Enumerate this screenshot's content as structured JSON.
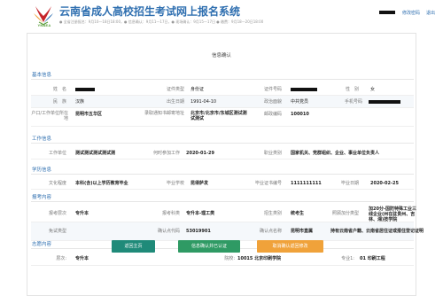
{
  "header": {
    "logo_text": "YNAEA",
    "title": "云南省成人高校招生考试网上报名系统",
    "schedule": "● 全省注册报名：9月10—18日18:00，● 信息确认：9月11—17日，● 现场确认：9月15—17日 ● 缴费：9月18—20日18:00",
    "change_password": "修改密码",
    "logout": "退出"
  },
  "panel_title": "信息确认",
  "sections": {
    "basic": "基本信息",
    "work": "工作信息",
    "education": "学历信息",
    "exam": "报考内容",
    "wishes": "志愿内容"
  },
  "basic": {
    "name_label": "姓　名",
    "cert_type_label": "证件类型",
    "cert_type": "身份证",
    "cert_no_label": "证件号码",
    "gender_label": "性　别",
    "gender": "女",
    "ethnic_label": "民　族",
    "ethnic": "汉族",
    "birth_label": "出生日期",
    "birth": "1991-04-10",
    "political_label": "政治面貌",
    "political": "中共党员",
    "phone_label": "手机号码",
    "hukou_label": "户口/工作单位所在地",
    "hukou": "昆明市五华区",
    "mail_label": "录取通知书邮寄地址",
    "mail": "北京市/北京市/东城区测试测试测试",
    "postcode_label": "邮政编码",
    "postcode": "100010"
  },
  "work": {
    "unit_label": "工作单位",
    "unit": "测试测试测试测试测",
    "start_label": "何时参加工作",
    "start": "2020-01-29",
    "job_label": "职业类别",
    "job": "国家机关、党群组织、企业、事业单位负责人"
  },
  "education": {
    "level_label": "文化程度",
    "level": "本科(含)以上学历教育毕业",
    "school_label": "毕业学校",
    "school": "昆得萨发",
    "cert_no_label": "毕业证书编号",
    "cert_no": "1111111111",
    "date_label": "毕业日期",
    "date": "2020-02-25"
  },
  "exam": {
    "level_label": "报考层次",
    "level": "专升本",
    "subject_label": "报考科类",
    "subject": "专升本-理工类",
    "category_label": "招生类别",
    "category": "统考生",
    "bonus_label": "照顾加分类型",
    "bonus": "加20分-国防特殊工业三线企业(州在驻贵州、吉林、湘)技学院",
    "exemption_label": "免试类型",
    "confirm_label": "确认点代码",
    "confirm_code": "53019901",
    "point_label": "确认点名称",
    "point_name": "昆明市直属",
    "note": "持有云南省户籍、云南省居住证或报住登记证明"
  },
  "wishes": {
    "level_label": "层次:",
    "level": "专升本",
    "school_label": "院校:",
    "school": "10015 北京印刷学院",
    "major_label": "专业1:",
    "major": "01 印刷工程"
  },
  "buttons": {
    "back": "返回主页",
    "confirm": "信息确认并已认证",
    "cancel": "取消确认返回修改"
  },
  "colors": {
    "brand_blue": "#2f6fb0",
    "btn_back": "#1f8a79",
    "btn_confirm": "#2f9a64",
    "btn_cancel": "#f0a23a"
  }
}
